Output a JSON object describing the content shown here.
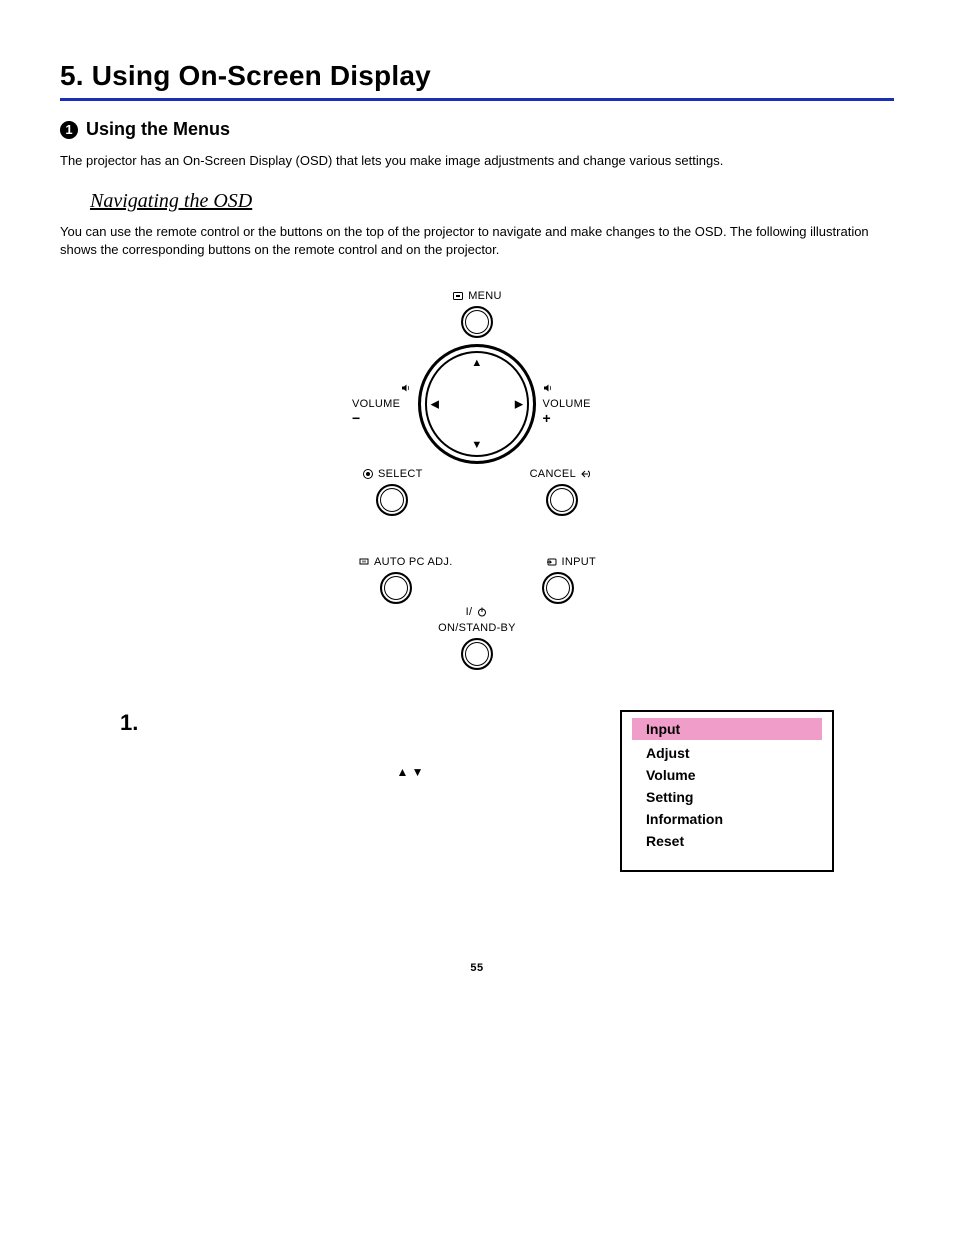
{
  "heading": "5. Using On-Screen Display",
  "section": {
    "number": "1",
    "title": "Using the Menus",
    "intro": "The projector has an On-Screen Display (OSD) that lets you make image adjustments and change various settings."
  },
  "subhead": "Navigating the OSD",
  "nav_para": "You can use the remote control or the buttons on the top of the projector to navigate and make changes to the OSD. The following illustration shows the corresponding buttons on the remote control and on the projector.",
  "controls": {
    "menu": "MENU",
    "volume_minus": "VOLUME",
    "volume_plus": "VOLUME",
    "select": "SELECT",
    "cancel": "CANCEL",
    "auto_pc": "AUTO PC ADJ.",
    "input": "INPUT",
    "power_sym": "I/",
    "standby": "ON/STAND-BY"
  },
  "step": {
    "number": "1.",
    "arrows": "▲   ▼"
  },
  "osd_menu": {
    "items": [
      {
        "label": "Input",
        "selected": true
      },
      {
        "label": "Adjust",
        "selected": false
      },
      {
        "label": "Volume",
        "selected": false
      },
      {
        "label": "Setting",
        "selected": false
      },
      {
        "label": "Information",
        "selected": false
      },
      {
        "label": "Reset",
        "selected": false
      }
    ]
  },
  "page_number": "55"
}
